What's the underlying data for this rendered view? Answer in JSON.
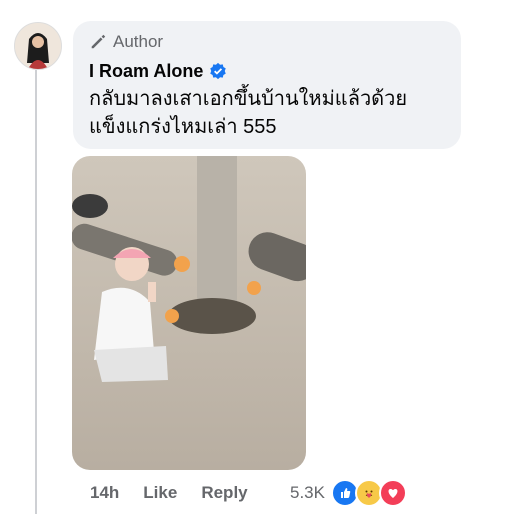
{
  "comment": {
    "badge_label": "Author",
    "author_name": "I Roam Alone",
    "text": "กลับมาลงเสาเอกขึ้นบ้านใหม่แล้วด้วย แข็งแกร่งไหมเล่า 555",
    "time": "14h",
    "like_label": "Like",
    "reply_label": "Reply",
    "reaction_count": "5.3K"
  },
  "icons": {
    "badge": "pencil-icon",
    "verified": "verified-badge-icon",
    "reactions": [
      "like-reaction-icon",
      "care-reaction-icon",
      "love-reaction-icon"
    ]
  },
  "colors": {
    "bubble": "#f0f2f5",
    "verified": "#1877f2",
    "secondary_text": "#65676b"
  }
}
